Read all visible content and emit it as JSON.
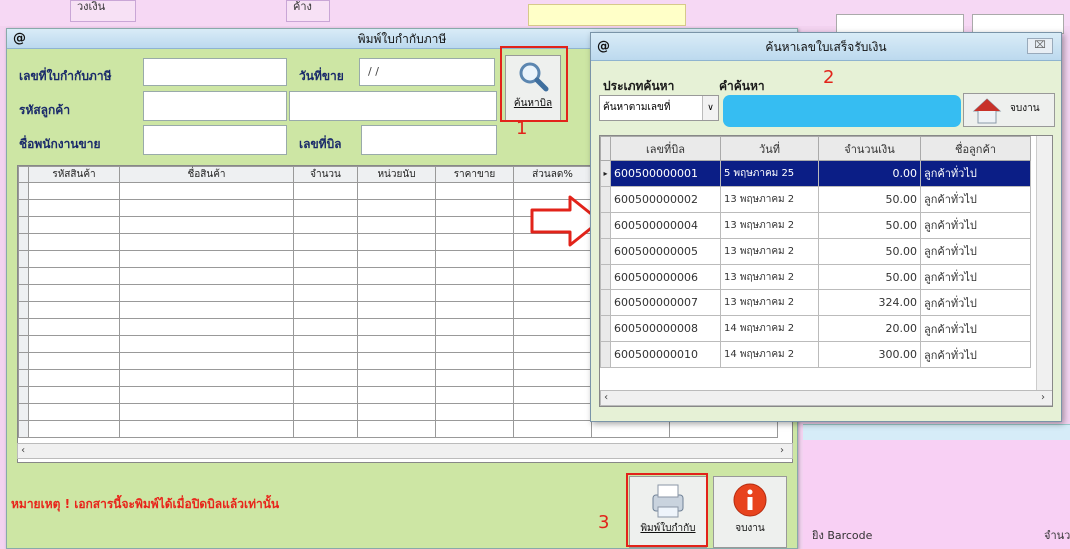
{
  "background": {
    "cell1": "วงเงิน",
    "cell2": "ค้าง",
    "barcode_label": "ยิง Barcode",
    "qty_label": "จำนว"
  },
  "main": {
    "title": "พิมพ์ใบกำกับภาษี",
    "at_symbol": "@",
    "label_tax_invoice_no": "เลขที่ใบกำกับภาษี",
    "label_sale_date": "วันที่ขาย",
    "sale_date_value": "/ /",
    "label_customer_code": "รหัสลูกค้า",
    "label_salesperson": "ชื่อพนักงานขาย",
    "label_bill_no": "เลขที่บิล",
    "search_bill_button": "ค้นหาบิล",
    "columns": [
      "รหัสสินค้า",
      "ชื่อสินค้า",
      "จำนวน",
      "หน่วยนับ",
      "ราคาขาย",
      "ส่วนลด%"
    ],
    "note": "หมายเหตุ ! เอกสารนี้จะพิมพ์ได้เมื่อปิดบิลแล้วเท่านั้น",
    "print_button": "พิมพ์ใบกำกับ",
    "close_button": "จบงาน"
  },
  "dialog": {
    "title": "ค้นหาเลขใบเสร็จรับเงิน",
    "at_symbol": "@",
    "close_glyph": "⌧",
    "label_search_type": "ประเภทค้นหา",
    "label_keyword": "คำค้นหา",
    "search_type_value": "ค้นหาตามเลขที่",
    "end_button": "จบงาน",
    "columns": [
      "เลขที่บิล",
      "วันที่",
      "จำนวนเงิน",
      "ชื่อลูกค้า"
    ],
    "rows": [
      {
        "bill": "600500000001",
        "date": "5 พฤษภาคม 25",
        "amount": "0.00",
        "customer": "ลูกค้าทั่วไป"
      },
      {
        "bill": "600500000002",
        "date": "13 พฤษภาคม 2",
        "amount": "50.00",
        "customer": "ลูกค้าทั่วไป"
      },
      {
        "bill": "600500000004",
        "date": "13 พฤษภาคม 2",
        "amount": "50.00",
        "customer": "ลูกค้าทั่วไป"
      },
      {
        "bill": "600500000005",
        "date": "13 พฤษภาคม 2",
        "amount": "50.00",
        "customer": "ลูกค้าทั่วไป"
      },
      {
        "bill": "600500000006",
        "date": "13 พฤษภาคม 2",
        "amount": "50.00",
        "customer": "ลูกค้าทั่วไป"
      },
      {
        "bill": "600500000007",
        "date": "13 พฤษภาคม 2",
        "amount": "324.00",
        "customer": "ลูกค้าทั่วไป"
      },
      {
        "bill": "600500000008",
        "date": "14 พฤษภาคม 2",
        "amount": "20.00",
        "customer": "ลูกค้าทั่วไป"
      },
      {
        "bill": "600500000010",
        "date": "14 พฤษภาคม 2",
        "amount": "300.00",
        "customer": "ลูกค้าทั่วไป"
      }
    ]
  },
  "annotations": {
    "n1": "1",
    "n2": "2",
    "n3": "3"
  },
  "colors": {
    "accent_red": "#e2231a",
    "selection": "#0b1e86",
    "search_box": "#36bdf2",
    "window_bg": "#cde6a4"
  }
}
